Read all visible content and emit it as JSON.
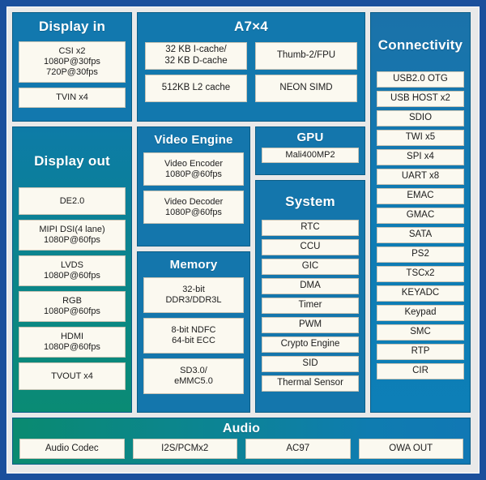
{
  "diagram": {
    "colors": {
      "outer_frame": "#1a4f9c",
      "canvas": "#e9e9e9",
      "panel_blue": "#1278ae",
      "panel_teal": "#0a8b74",
      "box_fill": "#fbf9f0",
      "title_text": "#ffffff",
      "box_text": "#1c1c1c"
    },
    "panels": {
      "display_in": {
        "title": "Display in",
        "items": [
          {
            "lines": [
              "CSI x2",
              "1080P@30fps",
              "720P@30fps"
            ]
          },
          {
            "lines": [
              "TVIN x4"
            ]
          }
        ]
      },
      "a7": {
        "title": "A7×4",
        "items": [
          {
            "lines": [
              "32 KB I-cache/",
              "32 KB D-cache"
            ]
          },
          {
            "lines": [
              "Thumb-2/FPU"
            ]
          },
          {
            "lines": [
              "512KB L2 cache"
            ]
          },
          {
            "lines": [
              "NEON SIMD"
            ]
          }
        ]
      },
      "connectivity": {
        "title": "Connectivity",
        "items": [
          {
            "lines": [
              "USB2.0 OTG"
            ]
          },
          {
            "lines": [
              "USB HOST x2"
            ]
          },
          {
            "lines": [
              "SDIO"
            ]
          },
          {
            "lines": [
              "TWI x5"
            ]
          },
          {
            "lines": [
              "SPI x4"
            ]
          },
          {
            "lines": [
              "UART x8"
            ]
          },
          {
            "lines": [
              "EMAC"
            ]
          },
          {
            "lines": [
              "GMAC"
            ]
          },
          {
            "lines": [
              "SATA"
            ]
          },
          {
            "lines": [
              "PS2"
            ]
          },
          {
            "lines": [
              "TSCx2"
            ]
          },
          {
            "lines": [
              "KEYADC"
            ]
          },
          {
            "lines": [
              "Keypad"
            ]
          },
          {
            "lines": [
              "SMC"
            ]
          },
          {
            "lines": [
              "RTP"
            ]
          },
          {
            "lines": [
              "CIR"
            ]
          }
        ]
      },
      "display_out": {
        "title": "Display out",
        "items": [
          {
            "lines": [
              "DE2.0"
            ]
          },
          {
            "lines": [
              "MIPI DSI(4 lane)",
              "1080P@60fps"
            ]
          },
          {
            "lines": [
              "LVDS",
              "1080P@60fps"
            ]
          },
          {
            "lines": [
              "RGB",
              "1080P@60fps"
            ]
          },
          {
            "lines": [
              "HDMI",
              "1080P@60fps"
            ]
          },
          {
            "lines": [
              "TVOUT x4"
            ]
          }
        ]
      },
      "video_engine": {
        "title": "Video Engine",
        "items": [
          {
            "lines": [
              "Video Encoder",
              "1080P@60fps"
            ]
          },
          {
            "lines": [
              "Video Decoder",
              "1080P@60fps"
            ]
          }
        ]
      },
      "memory": {
        "title": "Memory",
        "items": [
          {
            "lines": [
              "32-bit",
              "DDR3/DDR3L"
            ]
          },
          {
            "lines": [
              "8-bit NDFC",
              "64-bit ECC"
            ]
          },
          {
            "lines": [
              "SD3.0/",
              "eMMC5.0"
            ]
          }
        ]
      },
      "gpu": {
        "title": "GPU",
        "items": [
          {
            "lines": [
              "Mali400MP2"
            ]
          }
        ]
      },
      "system": {
        "title": "System",
        "items": [
          {
            "lines": [
              "RTC"
            ]
          },
          {
            "lines": [
              "CCU"
            ]
          },
          {
            "lines": [
              "GIC"
            ]
          },
          {
            "lines": [
              "DMA"
            ]
          },
          {
            "lines": [
              "Timer"
            ]
          },
          {
            "lines": [
              "PWM"
            ]
          },
          {
            "lines": [
              "Crypto Engine"
            ]
          },
          {
            "lines": [
              "SID"
            ]
          },
          {
            "lines": [
              "Thermal Sensor"
            ]
          }
        ]
      },
      "audio": {
        "title": "Audio",
        "items": [
          {
            "lines": [
              "Audio Codec"
            ]
          },
          {
            "lines": [
              "I2S/PCMx2"
            ]
          },
          {
            "lines": [
              "AC97"
            ]
          },
          {
            "lines": [
              "OWA OUT"
            ]
          }
        ]
      }
    }
  }
}
